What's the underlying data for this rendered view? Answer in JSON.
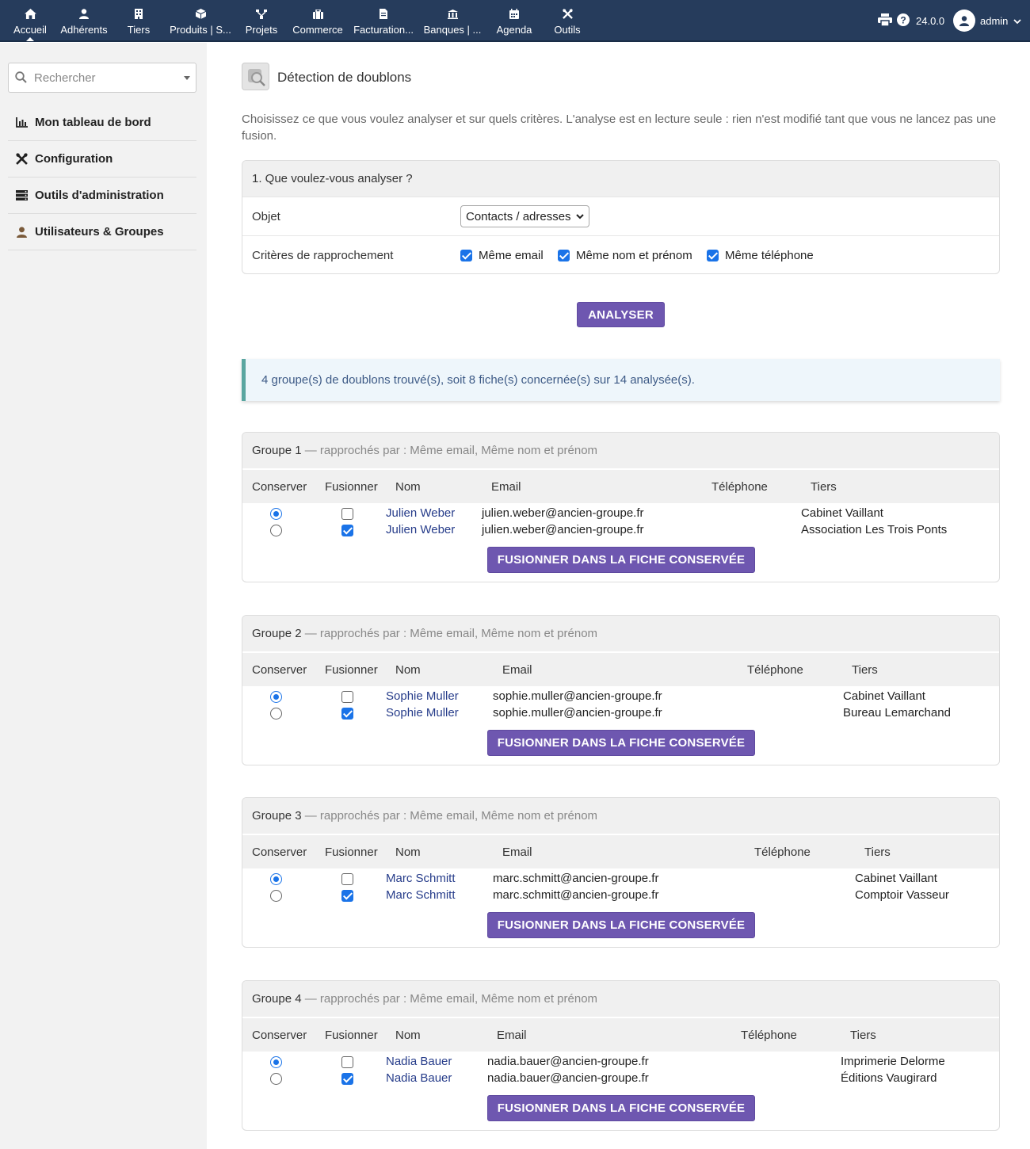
{
  "topbar": {
    "nav": [
      {
        "label": "Accueil",
        "icon": "home-icon"
      },
      {
        "label": "Adhérents",
        "icon": "user-icon"
      },
      {
        "label": "Tiers",
        "icon": "building-icon"
      },
      {
        "label": "Produits | S...",
        "icon": "cube-icon"
      },
      {
        "label": "Projets",
        "icon": "sitemap-icon"
      },
      {
        "label": "Commerce",
        "icon": "briefcase-icon"
      },
      {
        "label": "Facturation...",
        "icon": "invoice-icon"
      },
      {
        "label": "Banques | ...",
        "icon": "bank-icon"
      },
      {
        "label": "Agenda",
        "icon": "calendar-icon"
      },
      {
        "label": "Outils",
        "icon": "tools-icon"
      }
    ],
    "version": "24.0.0",
    "user": "admin"
  },
  "sidebar": {
    "search_placeholder": "Rechercher",
    "items": [
      {
        "label": "Mon tableau de bord",
        "icon": "chart-icon"
      },
      {
        "label": "Configuration",
        "icon": "tools-icon"
      },
      {
        "label": "Outils d'administration",
        "icon": "server-icon"
      },
      {
        "label": "Utilisateurs & Groupes",
        "icon": "user-icon"
      }
    ]
  },
  "main": {
    "title": "Détection de doublons",
    "intro": "Choisissez ce que vous voulez analyser et sur quels critères. L'analyse est en lecture seule : rien n'est modifié tant que vous ne lancez pas une fusion.",
    "form": {
      "heading": "1. Que voulez-vous analyser ?",
      "object_label": "Objet",
      "object_value": "Contacts / adresses",
      "criteria_label": "Critères de rapprochement",
      "criteria": [
        {
          "label": "Même email",
          "checked": true
        },
        {
          "label": "Même nom et prénom",
          "checked": true
        },
        {
          "label": "Même téléphone",
          "checked": true
        }
      ]
    },
    "analyze_button": "ANALYSER",
    "result_info": "4 groupe(s) de doublons trouvé(s), soit 8 fiche(s) concernée(s) sur 14 analysée(s).",
    "table_headers": {
      "keep": "Conserver",
      "merge": "Fusionner",
      "name": "Nom",
      "email": "Email",
      "phone": "Téléphone",
      "thirdparty": "Tiers"
    },
    "merge_button": "FUSIONNER DANS LA FICHE CONSERVÉE",
    "groups": [
      {
        "title": "Groupe 1",
        "reason": "— rapprochés par : Même email, Même nom et prénom",
        "rows": [
          {
            "keep": true,
            "merge": false,
            "name": "Julien Weber",
            "email": "julien.weber@ancien-groupe.fr",
            "phone": "",
            "thirdparty": "Cabinet Vaillant"
          },
          {
            "keep": false,
            "merge": true,
            "name": "Julien Weber",
            "email": "julien.weber@ancien-groupe.fr",
            "phone": "",
            "thirdparty": "Association Les Trois Ponts"
          }
        ]
      },
      {
        "title": "Groupe 2",
        "reason": "— rapprochés par : Même email, Même nom et prénom",
        "rows": [
          {
            "keep": true,
            "merge": false,
            "name": "Sophie Muller",
            "email": "sophie.muller@ancien-groupe.fr",
            "phone": "",
            "thirdparty": "Cabinet Vaillant"
          },
          {
            "keep": false,
            "merge": true,
            "name": "Sophie Muller",
            "email": "sophie.muller@ancien-groupe.fr",
            "phone": "",
            "thirdparty": "Bureau Lemarchand"
          }
        ]
      },
      {
        "title": "Groupe 3",
        "reason": "— rapprochés par : Même email, Même nom et prénom",
        "rows": [
          {
            "keep": true,
            "merge": false,
            "name": "Marc Schmitt",
            "email": "marc.schmitt@ancien-groupe.fr",
            "phone": "",
            "thirdparty": "Cabinet Vaillant"
          },
          {
            "keep": false,
            "merge": true,
            "name": "Marc Schmitt",
            "email": "marc.schmitt@ancien-groupe.fr",
            "phone": "",
            "thirdparty": "Comptoir Vasseur"
          }
        ]
      },
      {
        "title": "Groupe 4",
        "reason": "— rapprochés par : Même email, Même nom et prénom",
        "rows": [
          {
            "keep": true,
            "merge": false,
            "name": "Nadia Bauer",
            "email": "nadia.bauer@ancien-groupe.fr",
            "phone": "",
            "thirdparty": "Imprimerie Delorme"
          },
          {
            "keep": false,
            "merge": true,
            "name": "Nadia Bauer",
            "email": "nadia.bauer@ancien-groupe.fr",
            "phone": "",
            "thirdparty": "Éditions Vaugirard"
          }
        ]
      }
    ]
  }
}
